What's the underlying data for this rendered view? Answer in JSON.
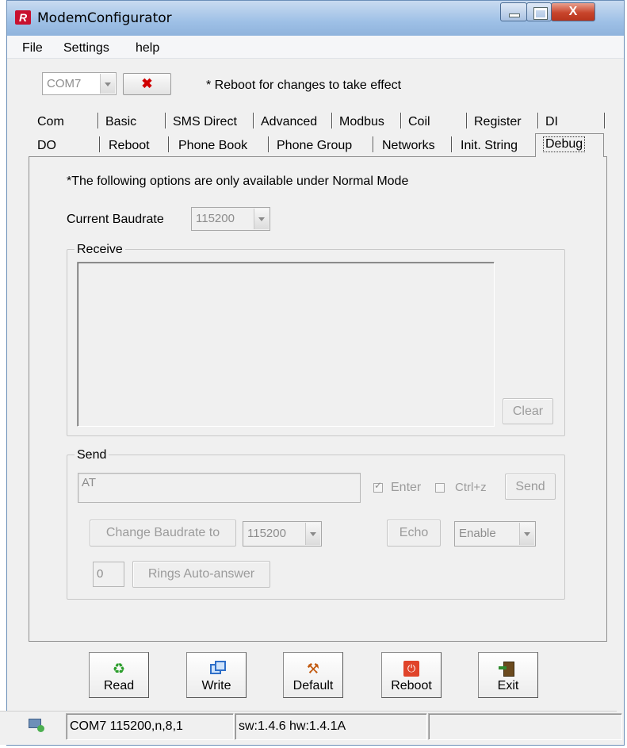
{
  "window": {
    "title": "ModemConfigurator",
    "close_glyph": "X"
  },
  "menu": [
    "File",
    "Settings",
    "help"
  ],
  "port": {
    "selected": "COM7",
    "disconnect_glyph": "✖",
    "reboot_note": "* Reboot for changes to take effect"
  },
  "tabs_row1": [
    "Com",
    "Basic",
    "SMS Direct",
    "Advanced",
    "Modbus",
    "Coil",
    "Register",
    "DI"
  ],
  "tabs_row2": [
    "DO",
    "Reboot",
    "Phone Book",
    "Phone Group",
    "Networks",
    "Init. String",
    "Debug"
  ],
  "debug": {
    "note": "*The following options are only available under Normal Mode",
    "baud_label": "Current Baudrate",
    "baud_value": "115200",
    "receive": {
      "legend": "Receive",
      "clear_label": "Clear"
    },
    "send": {
      "legend": "Send",
      "text": "AT",
      "enter_label": "Enter",
      "ctrlz_label": "Ctrl+z",
      "send_label": "Send",
      "change_baud_label": "Change Baudrate to",
      "change_baud_value": "115200",
      "echo_label": "Echo",
      "echo_value": "Enable",
      "rings_value": "0",
      "rings_label": "Rings Auto-answer"
    }
  },
  "toolbar": {
    "read": "Read",
    "write": "Write",
    "default": "Default",
    "reboot": "Reboot",
    "exit": "Exit"
  },
  "status": {
    "port_info": "COM7 115200,n,8,1",
    "version": "sw:1.4.6 hw:1.4.1A"
  }
}
